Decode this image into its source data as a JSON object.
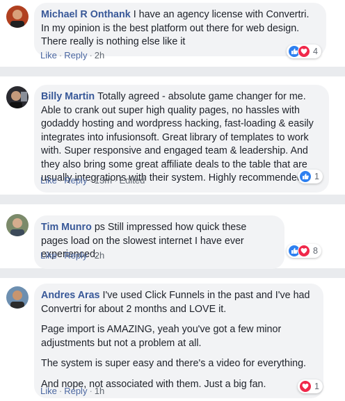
{
  "colors": {
    "link": "#385898",
    "like": "#2e80f0",
    "love": "#f0284a",
    "bubble": "#f2f3f5"
  },
  "actions": {
    "like": "Like",
    "reply": "Reply",
    "separator": "·"
  },
  "comments": [
    {
      "author": "Michael R Onthank",
      "paragraphs": [
        "I have an agency license with Convertri. In my opinion is the best platform out there for web design. There really is nothing else like it"
      ],
      "time": "2h",
      "edited": "",
      "reactions": [
        "like-icon",
        "love-icon"
      ],
      "reaction_count": "4"
    },
    {
      "author": "Billy Martin",
      "paragraphs": [
        "Totally agreed - absolute game changer for me. Able to crank out super high quality pages, no hassles with godaddy hosting and wordpress hacking, fast-loading & easily integrates into infusionsoft. Great library of templates to work with. Super responsive and engaged team & leadership. And they also bring some great affiliate deals to the table that are usually integrations with their system. Highly recommended"
      ],
      "time": "13m",
      "edited": "Edited",
      "reactions": [
        "like-icon"
      ],
      "reaction_count": "1"
    },
    {
      "author": "Tim Munro",
      "paragraphs": [
        "ps Still impressed how quick these pages load on the slowest internet I have ever experienced."
      ],
      "time": "2h",
      "edited": "",
      "reactions": [
        "like-icon",
        "love-icon"
      ],
      "reaction_count": "8"
    },
    {
      "author": "Andres Aras",
      "paragraphs": [
        "I've used Click Funnels in the past and I've had Convertri for about 2 months and LOVE it.",
        "Page import is AMAZING, yeah you've got a few minor adjustments but not a problem at all.",
        "The system is super easy and there's a video for everything.",
        "And nope, not associated with them. Just a big fan."
      ],
      "time": "1h",
      "edited": "",
      "reactions": [
        "love-icon"
      ],
      "reaction_count": "1"
    }
  ]
}
